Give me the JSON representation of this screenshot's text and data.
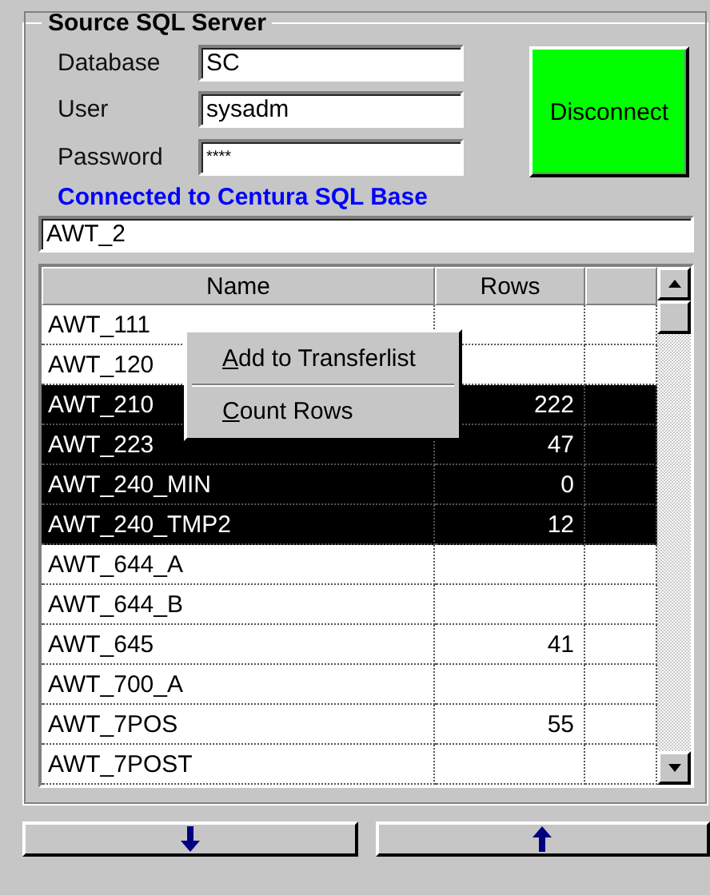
{
  "group": {
    "title": "Source SQL Server"
  },
  "fields": [
    {
      "label": "Database",
      "value": "SC",
      "kind": "text"
    },
    {
      "label": "User",
      "value": "sysadm",
      "kind": "text"
    },
    {
      "label": "Password",
      "value": "****",
      "kind": "password"
    }
  ],
  "connect_button": {
    "label": "Disconnect",
    "connected": true
  },
  "status": "Connected to Centura SQL Base",
  "filter": {
    "value": "AWT_2"
  },
  "table": {
    "columns": [
      {
        "label": "Name"
      },
      {
        "label": "Rows"
      }
    ],
    "rows": [
      {
        "name": "AWT_111",
        "rows": "",
        "selected": false
      },
      {
        "name": "AWT_120",
        "rows": "",
        "selected": false
      },
      {
        "name": "AWT_210",
        "rows": "222",
        "selected": true
      },
      {
        "name": "AWT_223",
        "rows": "47",
        "selected": true
      },
      {
        "name": "AWT_240_MIN",
        "rows": "0",
        "selected": true
      },
      {
        "name": "AWT_240_TMP2",
        "rows": "12",
        "selected": true
      },
      {
        "name": "AWT_644_A",
        "rows": "",
        "selected": false
      },
      {
        "name": "AWT_644_B",
        "rows": "",
        "selected": false
      },
      {
        "name": "AWT_645",
        "rows": "41",
        "selected": false
      },
      {
        "name": "AWT_700_A",
        "rows": "",
        "selected": false
      },
      {
        "name": "AWT_7POS",
        "rows": "55",
        "selected": false
      },
      {
        "name": "AWT_7POST",
        "rows": "",
        "selected": false
      }
    ]
  },
  "context_menu": {
    "items": [
      {
        "label": "Add to Transferlist",
        "first_letter_underlined": true
      },
      {
        "label": "Count Rows",
        "first_letter_underlined": true
      }
    ]
  },
  "bottom_buttons": [
    {
      "kind": "down"
    },
    {
      "kind": "up"
    }
  ]
}
